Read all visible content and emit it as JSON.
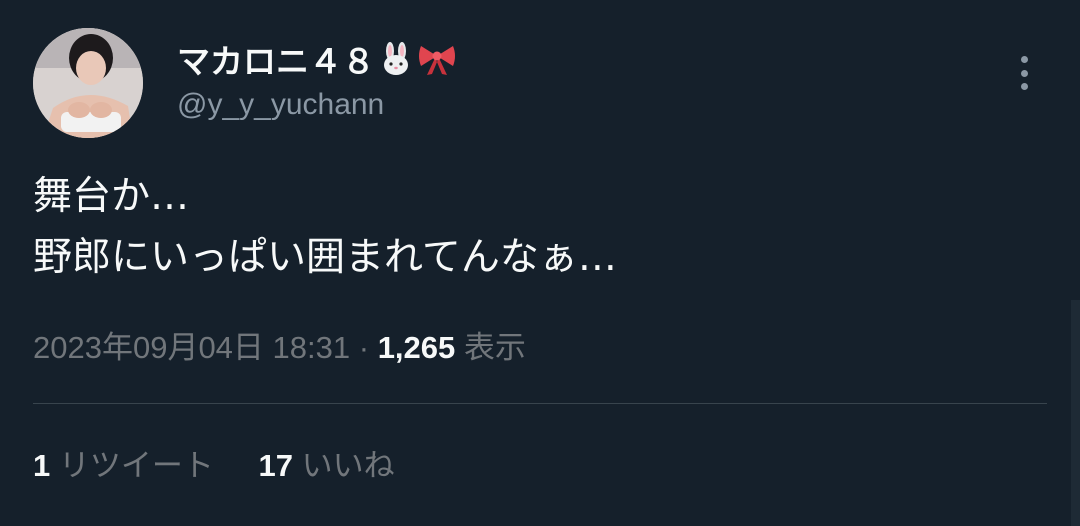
{
  "author": {
    "display_name": "マカロニ４８",
    "emojis": [
      "rabbit-face",
      "ribbon"
    ],
    "handle": "@y_y_yuchann",
    "avatar_icon": "profile-photo"
  },
  "tweet": {
    "lines": [
      "舞台か…",
      "野郎にいっぱい囲まれてんなぁ…"
    ]
  },
  "meta": {
    "timestamp": "2023年09月04日 18:31",
    "separator": " · ",
    "views_count": "1,265",
    "views_label": "表示"
  },
  "stats": {
    "retweets_count": "1",
    "retweets_label": "リツイート",
    "likes_count": "17",
    "likes_label": "いいね"
  },
  "colors": {
    "background": "#15202b",
    "primary_text": "#f7f9f9",
    "secondary_text": "#71767b",
    "divider": "#38444d"
  }
}
